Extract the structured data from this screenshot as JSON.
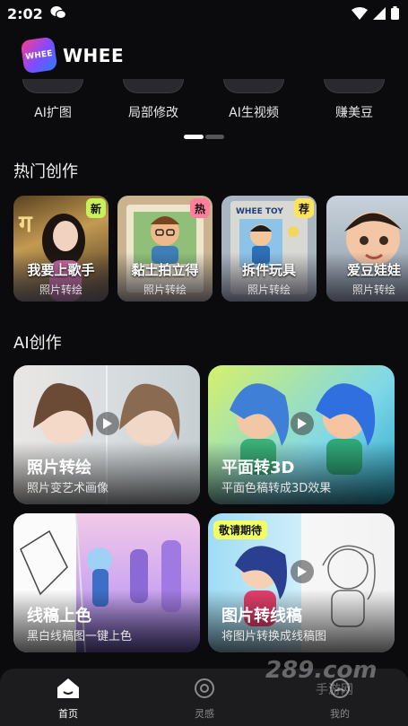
{
  "status_bar": {
    "time": "2:02"
  },
  "app": {
    "logo_badge": "WHEE",
    "name": "WHEE"
  },
  "tools": [
    {
      "label": "AI扩图"
    },
    {
      "label": "局部修改"
    },
    {
      "label": "AI生视频"
    },
    {
      "label": "赚美豆"
    }
  ],
  "sections": {
    "hot": "热门创作",
    "ai": "AI创作"
  },
  "hot_cards": [
    {
      "title": "我要上歌手",
      "subtitle": "照片转绘",
      "tag": "新",
      "tag_color": "#c8f25a"
    },
    {
      "title": "黏土拍立得",
      "subtitle": "照片转绘",
      "tag": "热",
      "tag_color": "#ff7f9c"
    },
    {
      "title": "拆件玩具",
      "subtitle": "照片转绘",
      "tag": "荐",
      "tag_color": "#ffe35a"
    },
    {
      "title": "爱豆娃娃",
      "subtitle": "照片转绘"
    }
  ],
  "ai_cards": [
    {
      "title": "照片转绘",
      "desc": "照片变艺术画像"
    },
    {
      "title": "平面转3D",
      "desc": "平面色稿转成3D效果"
    },
    {
      "title": "线稿上色",
      "desc": "黑白线稿图一键上色"
    },
    {
      "title": "图片转线稿",
      "desc": "将图片转换成线稿图",
      "badge": "敬请期待"
    }
  ],
  "nav": [
    {
      "label": "首页",
      "icon": "home-icon",
      "active": true
    },
    {
      "label": "灵感",
      "icon": "inspiration-icon",
      "active": false
    },
    {
      "label": "我的",
      "icon": "profile-icon",
      "active": false
    }
  ],
  "watermark": {
    "main": "289.com",
    "sub": "手游网"
  }
}
